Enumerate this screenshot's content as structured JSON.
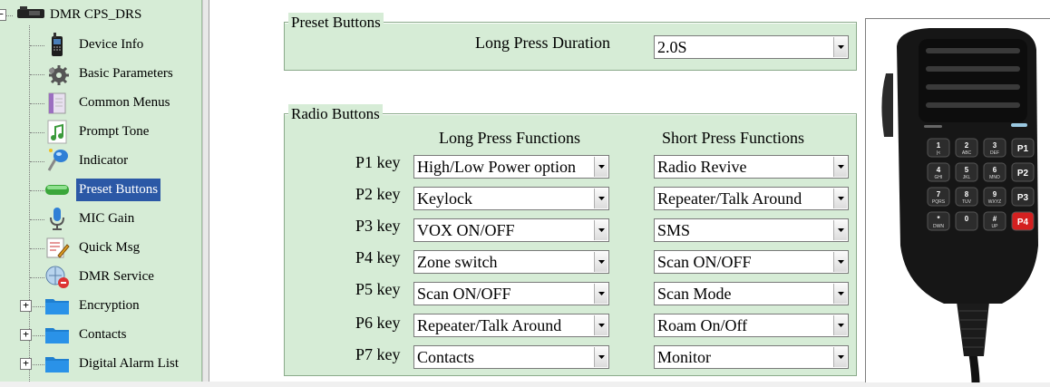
{
  "tree": {
    "root_label": "DMR CPS_DRS",
    "items": [
      {
        "label": "Device Info",
        "icon": "radio-device-icon"
      },
      {
        "label": "Basic Parameters",
        "icon": "gear-icon"
      },
      {
        "label": "Common Menus",
        "icon": "menu-book-icon"
      },
      {
        "label": "Prompt Tone",
        "icon": "music-note-icon"
      },
      {
        "label": "Indicator",
        "icon": "indicator-light-icon"
      },
      {
        "label": "Preset Buttons",
        "icon": "green-button-icon",
        "selected": true
      },
      {
        "label": "MIC Gain",
        "icon": "microphone-icon"
      },
      {
        "label": "Quick Msg",
        "icon": "edit-message-icon"
      },
      {
        "label": "DMR Service",
        "icon": "dmr-service-icon"
      },
      {
        "label": "Encryption",
        "icon": "folder-icon",
        "expandable": true
      },
      {
        "label": "Contacts",
        "icon": "folder-icon",
        "expandable": true
      },
      {
        "label": "Digital Alarm List",
        "icon": "folder-icon",
        "expandable": true
      }
    ],
    "expander_symbol": "+",
    "collapse_symbol": "−"
  },
  "preset_group": {
    "title": "Preset Buttons",
    "long_press_duration_label": "Long Press Duration",
    "long_press_duration_value": "2.0S"
  },
  "radio_group": {
    "title": "Radio Buttons",
    "long_header": "Long Press Functions",
    "short_header": "Short Press Functions",
    "keys": [
      {
        "label": "P1 key",
        "long": "High/Low Power option",
        "short": "Radio Revive"
      },
      {
        "label": "P2 key",
        "long": "Keylock",
        "short": "Repeater/Talk Around"
      },
      {
        "label": "P3 key",
        "long": "VOX ON/OFF",
        "short": "SMS"
      },
      {
        "label": "P4 key",
        "long": "Zone switch",
        "short": "Scan ON/OFF"
      },
      {
        "label": "P5 key",
        "long": "Scan ON/OFF",
        "short": "Scan Mode"
      },
      {
        "label": "P6 key",
        "long": "Repeater/Talk Around",
        "short": "Roam On/Off"
      },
      {
        "label": "P7 key",
        "long": "Contacts",
        "short": "Monitor"
      }
    ]
  },
  "mic_keypad": [
    [
      "1",
      "2",
      "3",
      "P1"
    ],
    [
      "4",
      "5",
      "6",
      "P2"
    ],
    [
      "7",
      "8",
      "9",
      "P3"
    ],
    [
      "*",
      "0",
      "#",
      "P4"
    ]
  ],
  "mic_keypad_sub": [
    [
      "|<",
      "ABC",
      "DEF",
      ""
    ],
    [
      "GHI",
      "JKL",
      "MNO",
      ""
    ],
    [
      "PQRS",
      "TUV",
      "WXYZ",
      ""
    ],
    [
      "DWN",
      "",
      "UP",
      ""
    ]
  ]
}
